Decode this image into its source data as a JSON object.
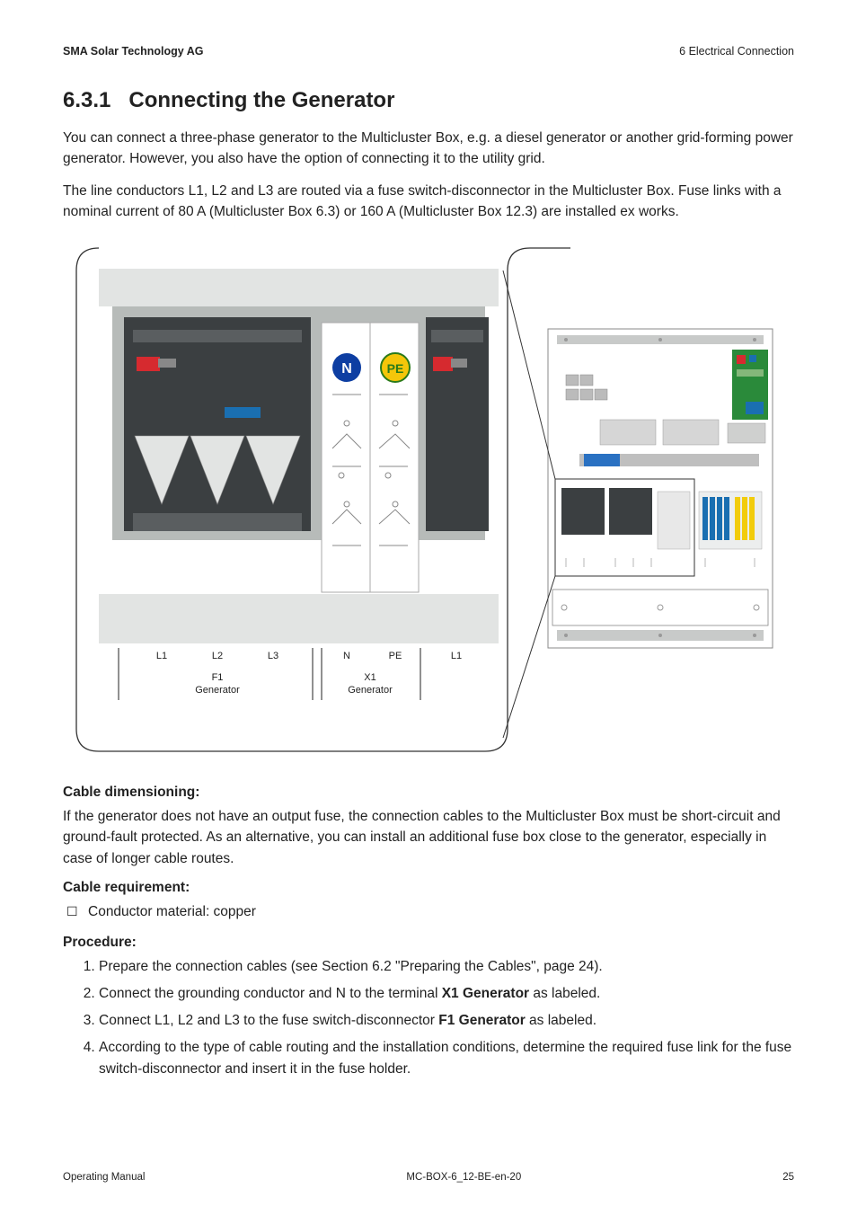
{
  "header": {
    "left": "SMA Solar Technology AG",
    "right": "6  Electrical Connection"
  },
  "section": {
    "number": "6.3.1",
    "title": "Connecting the Generator"
  },
  "paragraphs": {
    "p1": "You can connect a three-phase generator to the Multicluster Box, e.g. a diesel generator or another grid-forming power generator. However, you also have the option of connecting it to the utility grid.",
    "p2": "The line conductors L1, L2 and L3 are routed via a fuse switch-disconnector in the Multicluster Box. Fuse links with a nominal current of 80 A (Multicluster Box 6.3) or 160 A (Multicluster Box 12.3) are installed ex works."
  },
  "diagram": {
    "terminal_labels": {
      "t1": "L1",
      "t2": "L2",
      "t3": "L3",
      "t4": "N",
      "t5": "PE",
      "t6": "L1"
    },
    "block_labels": {
      "f1_code": "F1",
      "f1_text": "Generator",
      "x1_code": "X1",
      "x1_text": "Generator"
    },
    "symbols": {
      "n": "N",
      "pe": "PE"
    }
  },
  "cable_dimensioning": {
    "heading": "Cable dimensioning:",
    "text": "If the generator does not have an output fuse, the connection cables to the Multicluster Box must be short-circuit and ground-fault protected. As an alternative, you can install an additional fuse box close to the generator, especially in case of longer cable routes."
  },
  "cable_requirement": {
    "heading": "Cable requirement:",
    "items": [
      "Conductor material: copper"
    ]
  },
  "procedure": {
    "heading": "Procedure:",
    "steps": [
      {
        "pre": "Prepare the connection cables (see Section 6.2 \"Preparing the Cables\", page 24)."
      },
      {
        "pre": "Connect the grounding conductor and N to the terminal ",
        "bold": "X1 Generator",
        "post": " as labeled."
      },
      {
        "pre": "Connect L1, L2 and L3 to the fuse switch-disconnector ",
        "bold": "F1 Generator",
        "post": " as labeled."
      },
      {
        "pre": "According to the type of cable routing and the installation conditions, determine the required fuse link for the fuse switch-disconnector and insert it in the fuse holder."
      }
    ]
  },
  "footer": {
    "left": "Operating Manual",
    "center": "MC-BOX-6_12-BE-en-20",
    "right": "25"
  }
}
